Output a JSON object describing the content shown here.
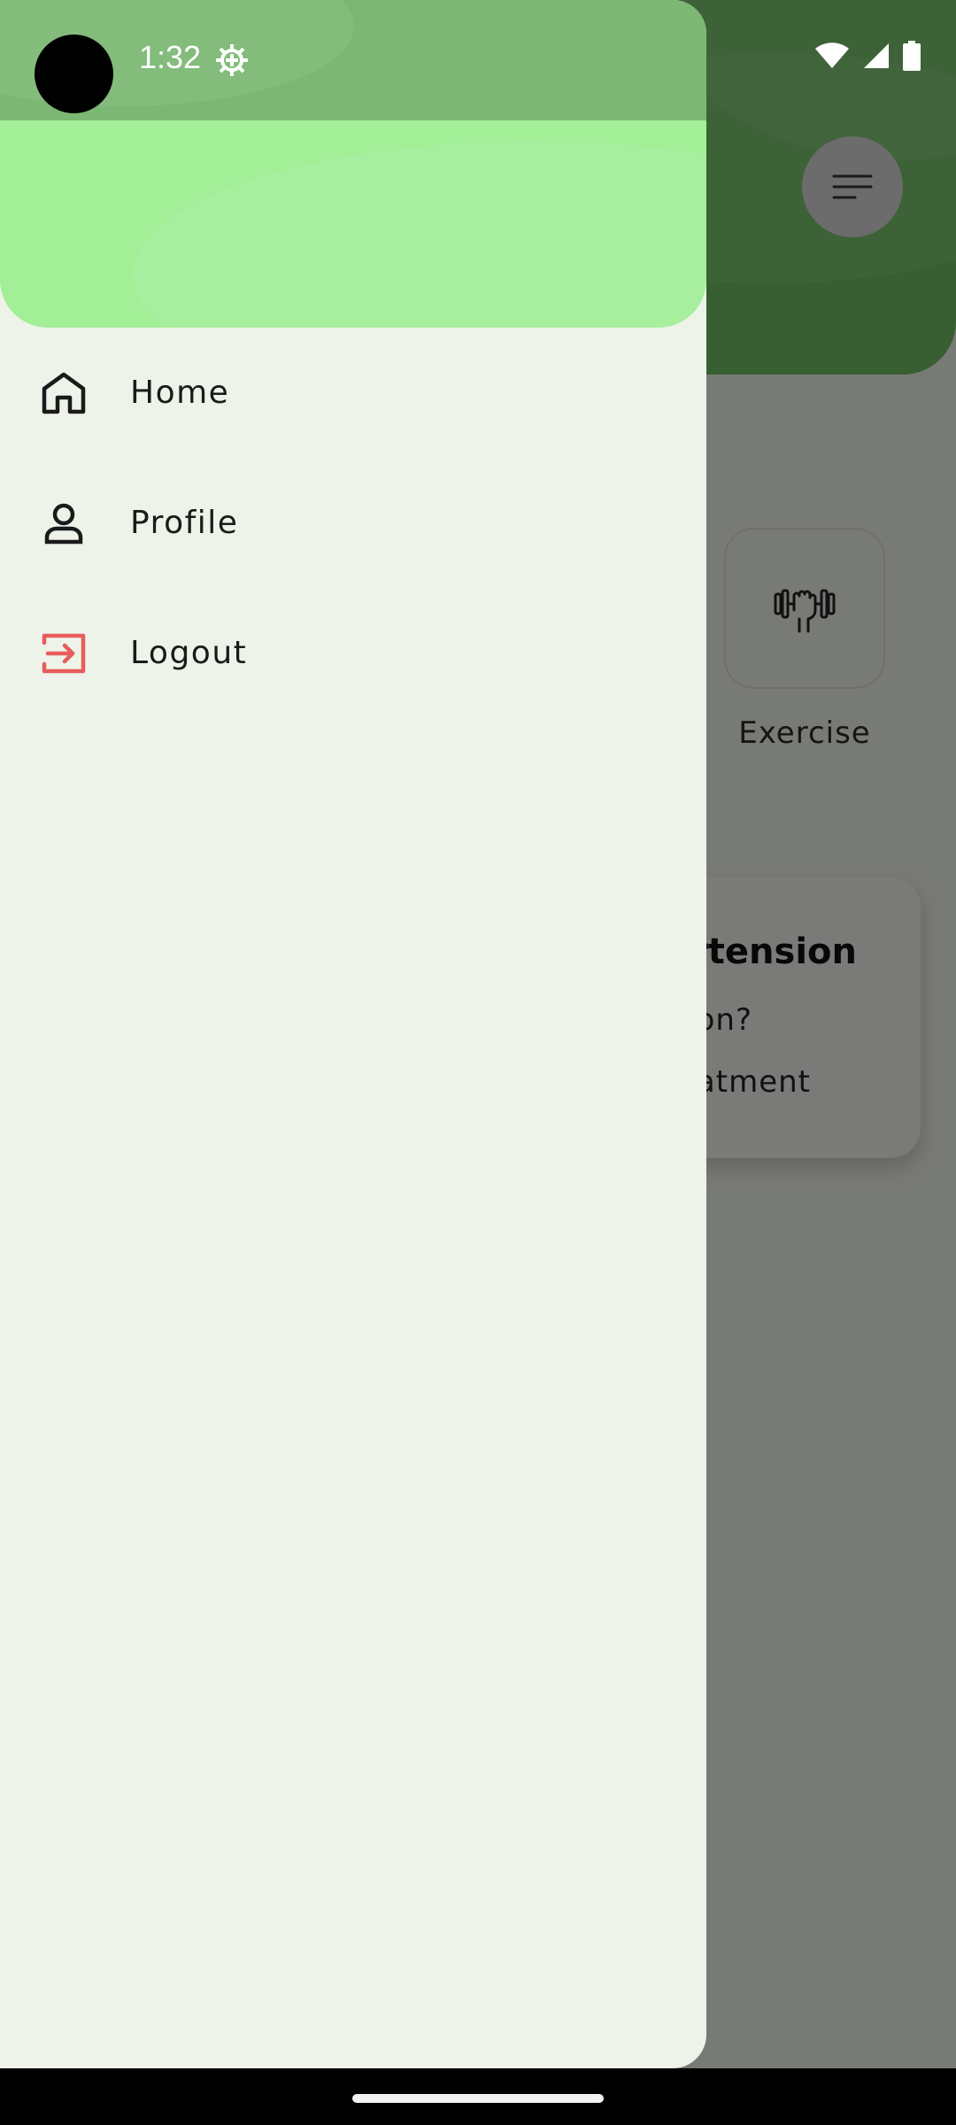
{
  "status_bar": {
    "time": "1:32",
    "icons": [
      "settings-gear-icon",
      "wifi-icon",
      "signal-icon",
      "battery-icon"
    ]
  },
  "background_app": {
    "menu_icon": "menu-lines-icon",
    "category_tile": {
      "icon": "dumbbell-hand-icon",
      "label": "Exercise"
    },
    "article_card": {
      "title": "rtension",
      "question": "on?",
      "treatment": "atment"
    }
  },
  "drawer": {
    "items": [
      {
        "label": "Home",
        "icon": "home-icon",
        "color": "#1a1a1a"
      },
      {
        "label": "Profile",
        "icon": "person-icon",
        "color": "#1a1a1a"
      },
      {
        "label": "Logout",
        "icon": "logout-icon",
        "color": "#e85c5c"
      }
    ]
  },
  "colors": {
    "drawer_header": "#a2ef98",
    "drawer_body": "#eef3e9",
    "app_header": "#6fbf63",
    "logout_accent": "#e85c5c"
  }
}
